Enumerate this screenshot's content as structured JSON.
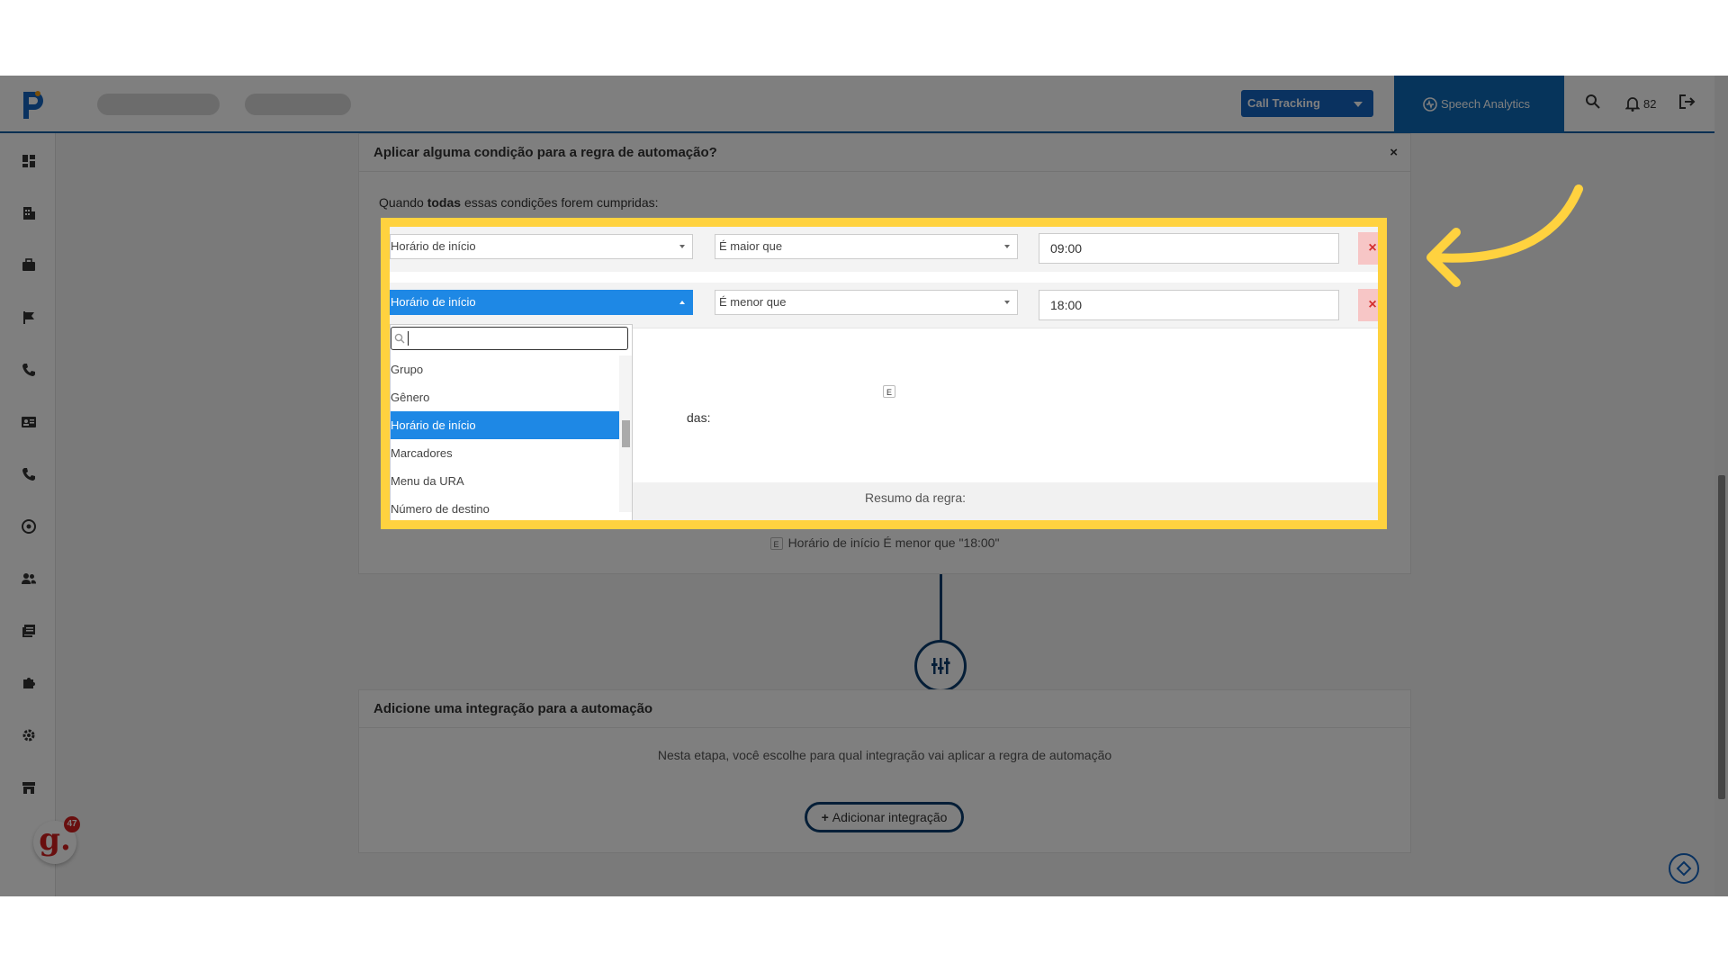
{
  "topbar": {
    "call_tracking_label": "Call Tracking",
    "speech_analytics_label": "Speech Analytics",
    "notifications_count": "82"
  },
  "colors": {
    "primary": "#1565c0",
    "navy": "#0b3d6e",
    "highlight": "#ffd23f",
    "selected": "#1e88e5",
    "delete_bg": "#f7c6c6",
    "delete_fg": "#d32f2f"
  },
  "sidebar": {
    "icons": [
      "dashboard-icon",
      "building-icon",
      "briefcase-icon",
      "flag-icon",
      "phone-icon",
      "contact-card-icon",
      "phone-icon",
      "speed-icon",
      "users-icon",
      "library-icon",
      "puzzle-icon",
      "gear-icon",
      "store-icon"
    ]
  },
  "condition_card": {
    "title": "Aplicar alguma condição para a regra de automação?",
    "close": "×",
    "when_prefix": "Quando ",
    "when_bold": "todas",
    "when_suffix": " essas condições forem cumpridas:",
    "rows": [
      {
        "field": "Horário de início",
        "operator": "É maior que",
        "value": "09:00",
        "delete": "×"
      },
      {
        "field": "Horário de início",
        "operator": "É menor que",
        "value": "18:00",
        "delete": "×"
      }
    ],
    "and_badge": "E",
    "partial_text": "das:",
    "summary_title": "Resumo da regra:",
    "summary_line_2": "Horário de início É menor que \"18:00\""
  },
  "dropdown": {
    "search_value": "",
    "options": [
      "Grupo",
      "Gênero",
      "Horário de início",
      "Marcadores",
      "Menu da URA",
      "Número de destino"
    ],
    "selected": "Horário de início"
  },
  "integration_card": {
    "title": "Adicione uma integração para a automação",
    "description": "Nesta etapa, você escolhe para qual integração vai aplicar a regra de automação",
    "button_label": "Adicionar integração",
    "button_icon": "plus-icon"
  },
  "avatar": {
    "letter": "g.",
    "count": "47"
  }
}
